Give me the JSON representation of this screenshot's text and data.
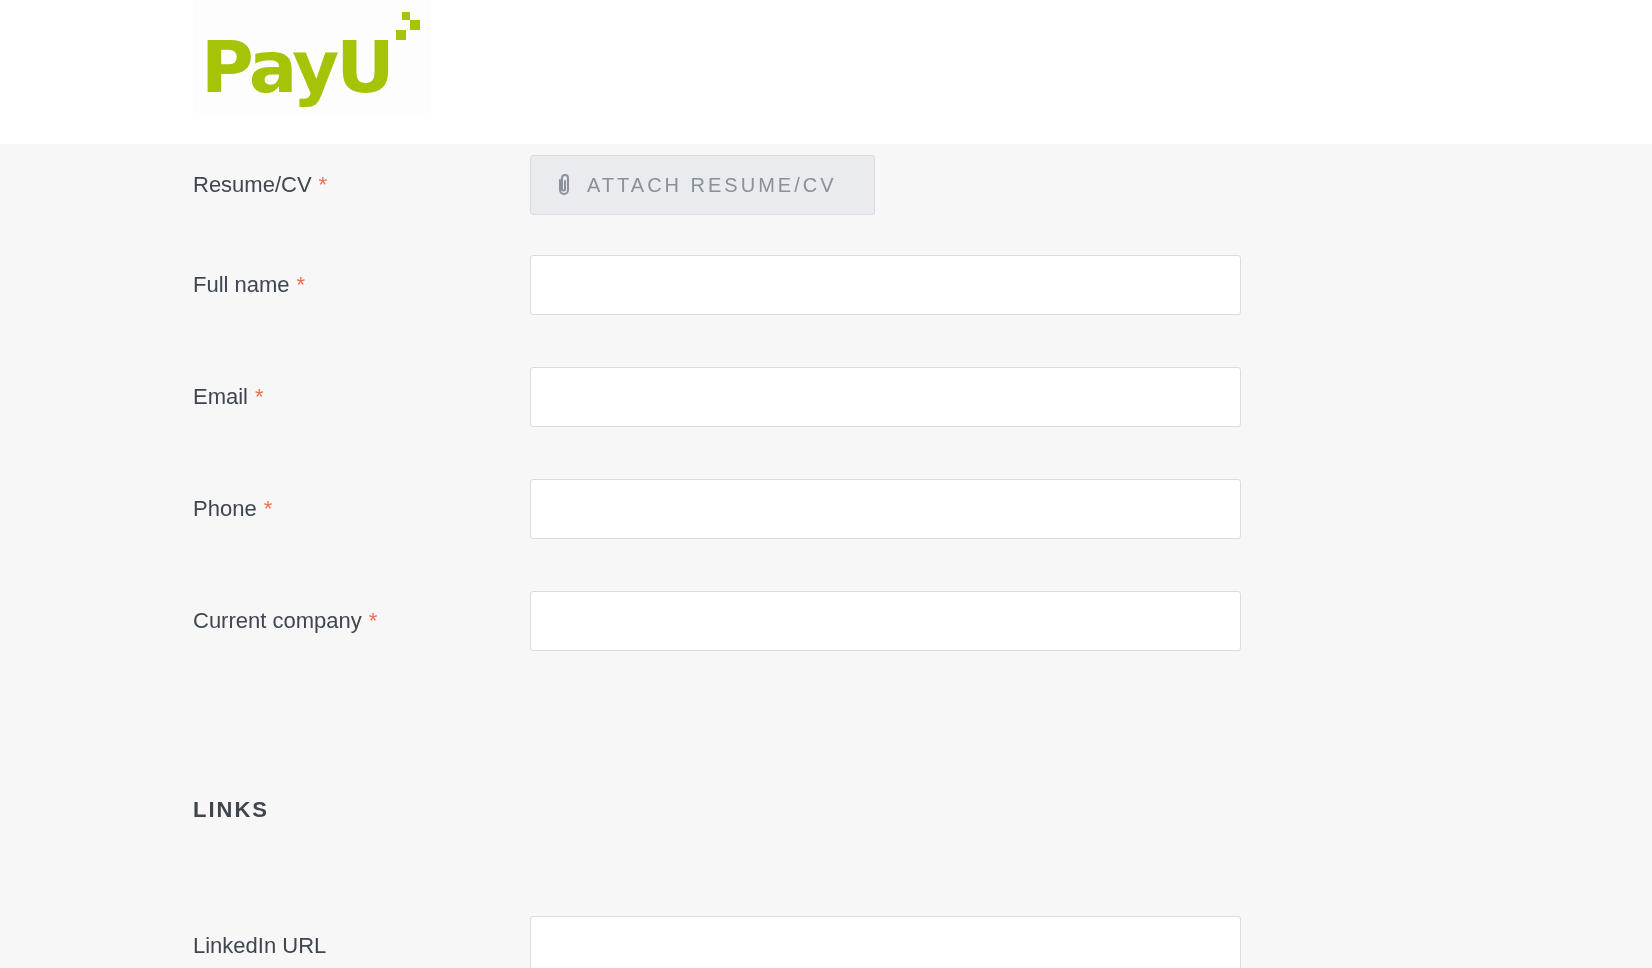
{
  "logo": {
    "text": "PayU"
  },
  "resume": {
    "label": "Resume/CV",
    "required_mark": "*",
    "button": "ATTACH RESUME/CV"
  },
  "fields": [
    {
      "label": "Full name",
      "required": true,
      "required_mark": "*"
    },
    {
      "label": "Email",
      "required": true,
      "required_mark": "*"
    },
    {
      "label": "Phone",
      "required": true,
      "required_mark": "*"
    },
    {
      "label": "Current company",
      "required": true,
      "required_mark": "*"
    }
  ],
  "links_heading": "LINKS",
  "link_fields": [
    {
      "label": "LinkedIn URL"
    }
  ]
}
